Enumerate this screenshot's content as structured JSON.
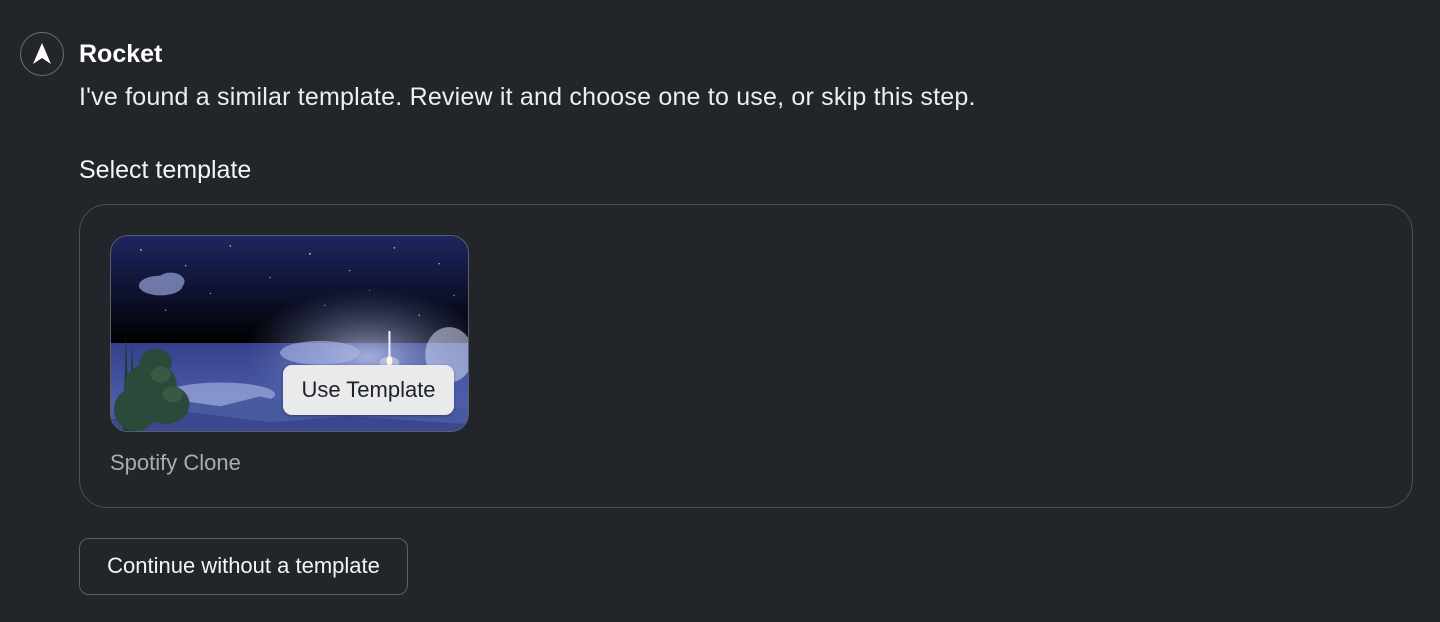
{
  "assistant": {
    "name": "Rocket",
    "icon": "rocket-logo-icon",
    "message": "I've found a similar template. Review it and choose one to use, or skip this step."
  },
  "template_section": {
    "title": "Select template",
    "templates": [
      {
        "name": "Spotify Clone",
        "preview_icon": "night-sky-rocket-launch-image",
        "action_label": "Use Template"
      }
    ]
  },
  "skip_button": {
    "label": "Continue without a template"
  },
  "colors": {
    "background": "#222529",
    "border": "#4b4f55",
    "button_light": "#e9eaec",
    "text_primary": "#f2f2f3",
    "text_muted": "#a9adb3"
  }
}
